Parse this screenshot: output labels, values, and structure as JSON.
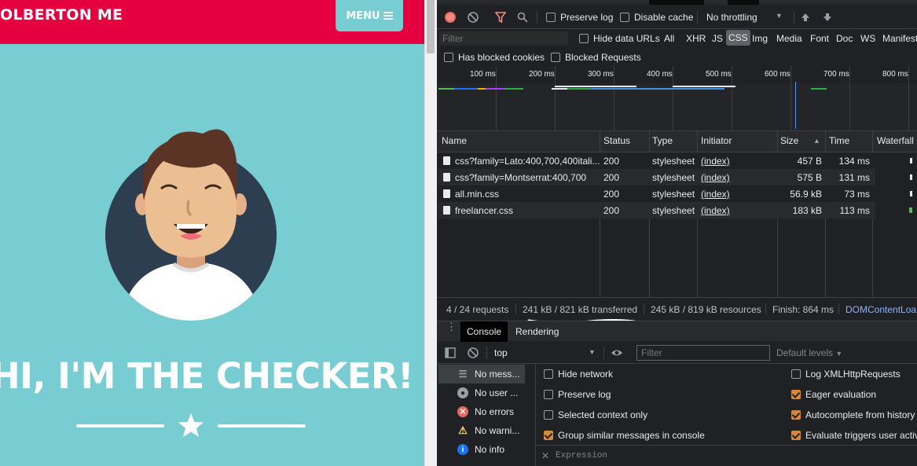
{
  "site": {
    "brand": "OLBERTON ME",
    "menu_label": "MENU",
    "hero_text": "HI, I'M THE CHECKER!"
  },
  "devtools": {
    "toolbar": {
      "preserve_log": "Preserve log",
      "disable_cache": "Disable cache",
      "throttling": "No throttling"
    },
    "filter_bar": {
      "filter_placeholder": "Filter",
      "hide_data_urls": "Hide data URLs",
      "types": [
        "All",
        "XHR",
        "JS",
        "CSS",
        "Img",
        "Media",
        "Font",
        "Doc",
        "WS",
        "Manifest"
      ],
      "active_type": "CSS"
    },
    "options": {
      "has_blocked_cookies": "Has blocked cookies",
      "blocked_requests": "Blocked Requests"
    },
    "timeline_ticks": [
      "100 ms",
      "200 ms",
      "300 ms",
      "400 ms",
      "500 ms",
      "600 ms",
      "700 ms",
      "800 ms"
    ],
    "table": {
      "headers": [
        "Name",
        "Status",
        "Type",
        "Initiator",
        "Size",
        "Time",
        "Waterfall"
      ],
      "rows": [
        {
          "name": "css?family=Lato:400,700,400itali...",
          "status": "200",
          "type": "stylesheet",
          "initiator": "(index)",
          "size": "457 B",
          "time": "134 ms"
        },
        {
          "name": "css?family=Montserrat:400,700",
          "status": "200",
          "type": "stylesheet",
          "initiator": "(index)",
          "size": "575 B",
          "time": "131 ms"
        },
        {
          "name": "all.min.css",
          "status": "200",
          "type": "stylesheet",
          "initiator": "(index)",
          "size": "56.9 kB",
          "time": "73 ms"
        },
        {
          "name": "freelancer.css",
          "status": "200",
          "type": "stylesheet",
          "initiator": "(index)",
          "size": "183 kB",
          "time": "113 ms"
        }
      ]
    },
    "summary": {
      "requests": "4 / 24 requests",
      "transferred": "241 kB / 821 kB transferred",
      "resources": "245 kB / 819 kB resources",
      "finish": "Finish: 864 ms",
      "domcontent": "DOMContentLoa"
    },
    "drawer_tabs": [
      "Console",
      "Rendering"
    ],
    "console": {
      "context": "top",
      "filter_placeholder": "Filter",
      "levels": "Default levels",
      "sidebar": [
        "No mess...",
        "No user ...",
        "No errors",
        "No warni...",
        "No info"
      ],
      "settings_left": [
        "Hide network",
        "Preserve log",
        "Selected context only",
        "Group similar messages in console"
      ],
      "settings_right": [
        "Log XMLHttpRequests",
        "Eager evaluation",
        "Autocomplete from history",
        "Evaluate triggers user activa"
      ],
      "expression_placeholder": "Expression"
    }
  },
  "colors": {
    "nav_red": "#e5003f",
    "teal": "#78cdd3",
    "accent_orange": "#d6883a",
    "link_blue": "#8ab4f8"
  }
}
